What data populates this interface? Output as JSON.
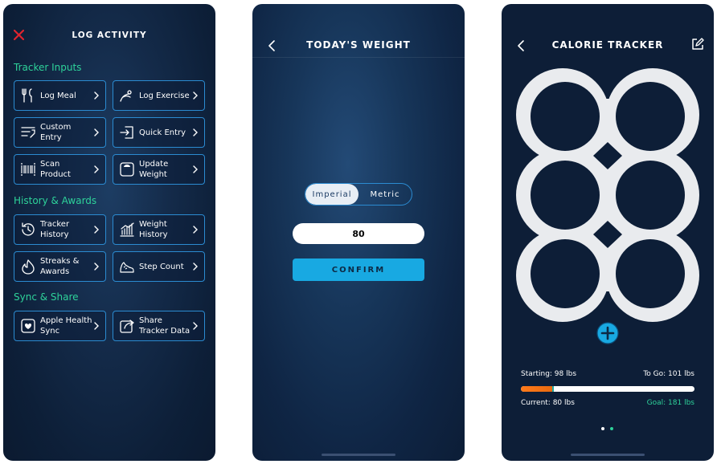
{
  "screen1": {
    "title": "LOG ACTIVITY",
    "sections": {
      "inputs": "Tracker Inputs",
      "history": "History & Awards",
      "sync": "Sync & Share"
    },
    "tiles": [
      {
        "label": "Log Meal",
        "icon": "fork-knife-icon"
      },
      {
        "label": "Log Exercise",
        "icon": "exercise-icon"
      },
      {
        "label": "Custom Entry",
        "icon": "custom-entry-icon"
      },
      {
        "label": "Quick Entry",
        "icon": "quick-entry-icon"
      },
      {
        "label": "Scan Product",
        "icon": "barcode-icon"
      },
      {
        "label": "Update Weight",
        "icon": "scale-icon"
      },
      {
        "label": "Tracker History",
        "icon": "history-icon"
      },
      {
        "label": "Weight History",
        "icon": "chart-icon"
      },
      {
        "label": "Streaks & Awards",
        "icon": "flame-icon"
      },
      {
        "label": "Step Count",
        "icon": "shoe-icon"
      },
      {
        "label": "Apple Health Sync",
        "icon": "health-icon"
      },
      {
        "label": "Share Tracker Data",
        "icon": "share-icon"
      }
    ]
  },
  "screen2": {
    "title": "TODAY'S WEIGHT",
    "units": [
      "Imperial",
      "Metric"
    ],
    "selected_unit": "Imperial",
    "weight_value": "80",
    "confirm_label": "CONFIRM"
  },
  "screen3": {
    "title": "CALORIE TRACKER",
    "starting": "Starting: 98 lbs",
    "to_go": "To Go: 101 lbs",
    "current": "Current: 80 lbs",
    "goal": "Goal:  181 lbs",
    "progress_fraction": 0.18,
    "page_count": 2,
    "active_page": 2
  },
  "colors": {
    "accent_green": "#2ed39a",
    "accent_blue": "#2b8bd1",
    "close_red": "#e0242e",
    "progress_orange": "#ff7a1a"
  }
}
